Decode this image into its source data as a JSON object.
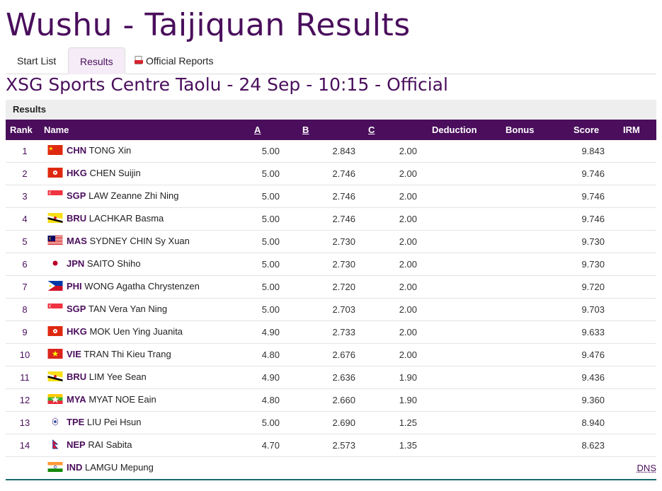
{
  "page": {
    "title": "Wushu - Taijiquan Results",
    "session": "XSG Sports Centre Taolu - 24 Sep - 10:15 - Official"
  },
  "tabs": [
    {
      "label": "Start List",
      "active": false
    },
    {
      "label": "Results",
      "active": true
    },
    {
      "label": "Official Reports",
      "active": false,
      "icon": "pdf-icon"
    }
  ],
  "section": {
    "label": "Results"
  },
  "columns": {
    "rank": "Rank",
    "name": "Name",
    "a": "A",
    "b": "B",
    "c": "C",
    "deduction": "Deduction",
    "bonus": "Bonus",
    "score": "Score",
    "irm": "IRM"
  },
  "colors": {
    "accent": "#4a0e5c",
    "header_bg": "#eeeeee",
    "tab_active_bg": "#f5ecf7"
  },
  "rows": [
    {
      "rank": "1",
      "noc": "CHN",
      "name": "TONG Xin",
      "a": "5.00",
      "b": "2.843",
      "c": "2.00",
      "score": "9.843",
      "irm": "",
      "flag": "chn"
    },
    {
      "rank": "2",
      "noc": "HKG",
      "name": "CHEN Suijin",
      "a": "5.00",
      "b": "2.746",
      "c": "2.00",
      "score": "9.746",
      "irm": "",
      "flag": "hkg"
    },
    {
      "rank": "3",
      "noc": "SGP",
      "name": "LAW Zeanne Zhi Ning",
      "a": "5.00",
      "b": "2.746",
      "c": "2.00",
      "score": "9.746",
      "irm": "",
      "flag": "sgp"
    },
    {
      "rank": "4",
      "noc": "BRU",
      "name": "LACHKAR Basma",
      "a": "5.00",
      "b": "2.746",
      "c": "2.00",
      "score": "9.746",
      "irm": "",
      "flag": "bru"
    },
    {
      "rank": "5",
      "noc": "MAS",
      "name": "SYDNEY CHIN Sy Xuan",
      "a": "5.00",
      "b": "2.730",
      "c": "2.00",
      "score": "9.730",
      "irm": "",
      "flag": "mas"
    },
    {
      "rank": "6",
      "noc": "JPN",
      "name": "SAITO Shiho",
      "a": "5.00",
      "b": "2.730",
      "c": "2.00",
      "score": "9.730",
      "irm": "",
      "flag": "jpn"
    },
    {
      "rank": "7",
      "noc": "PHI",
      "name": "WONG Agatha Chrystenzen",
      "a": "5.00",
      "b": "2.720",
      "c": "2.00",
      "score": "9.720",
      "irm": "",
      "flag": "phi"
    },
    {
      "rank": "8",
      "noc": "SGP",
      "name": "TAN Vera Yan Ning",
      "a": "5.00",
      "b": "2.703",
      "c": "2.00",
      "score": "9.703",
      "irm": "",
      "flag": "sgp"
    },
    {
      "rank": "9",
      "noc": "HKG",
      "name": "MOK Uen Ying Juanita",
      "a": "4.90",
      "b": "2.733",
      "c": "2.00",
      "score": "9.633",
      "irm": "",
      "flag": "hkg"
    },
    {
      "rank": "10",
      "noc": "VIE",
      "name": "TRAN Thi Kieu Trang",
      "a": "4.80",
      "b": "2.676",
      "c": "2.00",
      "score": "9.476",
      "irm": "",
      "flag": "vie"
    },
    {
      "rank": "11",
      "noc": "BRU",
      "name": "LIM Yee Sean",
      "a": "4.90",
      "b": "2.636",
      "c": "1.90",
      "score": "9.436",
      "irm": "",
      "flag": "bru"
    },
    {
      "rank": "12",
      "noc": "MYA",
      "name": "MYAT NOE Eain",
      "a": "4.80",
      "b": "2.660",
      "c": "1.90",
      "score": "9.360",
      "irm": "",
      "flag": "mya"
    },
    {
      "rank": "13",
      "noc": "TPE",
      "name": "LIU Pei Hsun",
      "a": "5.00",
      "b": "2.690",
      "c": "1.25",
      "score": "8.940",
      "irm": "",
      "flag": "tpe"
    },
    {
      "rank": "14",
      "noc": "NEP",
      "name": "RAI Sabita",
      "a": "4.70",
      "b": "2.573",
      "c": "1.35",
      "score": "8.623",
      "irm": "",
      "flag": "nep"
    },
    {
      "rank": "",
      "noc": "IND",
      "name": "LAMGU Mepung",
      "a": "",
      "b": "",
      "c": "",
      "score": "",
      "irm": "DNS",
      "flag": "ind"
    }
  ]
}
